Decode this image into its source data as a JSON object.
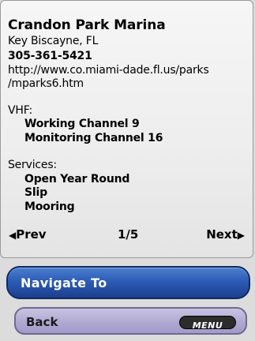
{
  "marina": {
    "name": "Crandon Park Marina",
    "location": "Key Biscayne, FL",
    "phone": "305-361-5421",
    "url_line1": "http://www.co.miami-dade.fl.us/parks",
    "url_line2": "/mparks6.htm"
  },
  "vhf": {
    "heading": "VHF:",
    "working": "Working Channel 9",
    "monitoring": "Monitoring Channel 16"
  },
  "services": {
    "heading": "Services:",
    "items": [
      "Open Year Round",
      "Slip",
      "Mooring"
    ]
  },
  "pager": {
    "prev_label": "Prev",
    "page": "1/5",
    "next_label": "Next",
    "prev_icon": "triangle-left-icon",
    "next_icon": "triangle-right-icon"
  },
  "actions": {
    "navigate_label": "Navigate To",
    "back_label": "Back",
    "menu_label": "MENU"
  },
  "colors": {
    "navigate_button": "#2c5cb5",
    "back_button": "#b0a9d2",
    "menu_badge": "#2c2c2c"
  }
}
